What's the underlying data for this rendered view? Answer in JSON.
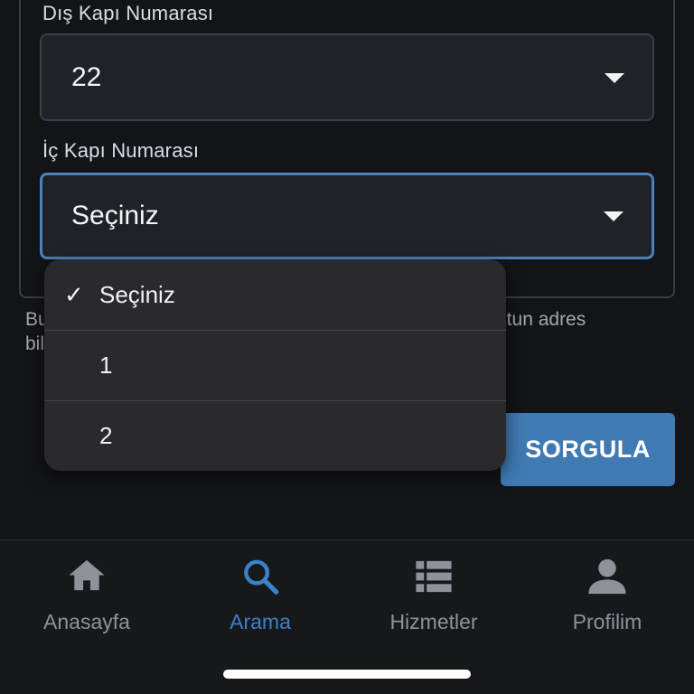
{
  "form": {
    "outer_door_label": "Dış Kapı Numarası",
    "outer_door_value": "22",
    "inner_door_label": "İç Kapı Numarası",
    "inner_door_value": "Seçiniz"
  },
  "info": {
    "line1_start": "Bu",
    "line1_end": "utun adres",
    "line2_start": "bil"
  },
  "dropdown": {
    "options": [
      {
        "label": "Seçiniz",
        "selected": true
      },
      {
        "label": "1",
        "selected": false
      },
      {
        "label": "2",
        "selected": false
      }
    ],
    "check_mark": "✓"
  },
  "query_button": {
    "label": "SORGULA"
  },
  "tabbar": {
    "tabs": [
      {
        "label": "Anasayfa",
        "icon": "home-icon",
        "active": false
      },
      {
        "label": "Arama",
        "icon": "search-icon",
        "active": true
      },
      {
        "label": "Hizmetler",
        "icon": "list-icon",
        "active": false
      },
      {
        "label": "Profilim",
        "icon": "person-icon",
        "active": false
      }
    ]
  },
  "colors": {
    "background": "#131417",
    "accent": "#3b82c9",
    "button": "#3f7ab2",
    "focus_border": "#4d82b8"
  }
}
